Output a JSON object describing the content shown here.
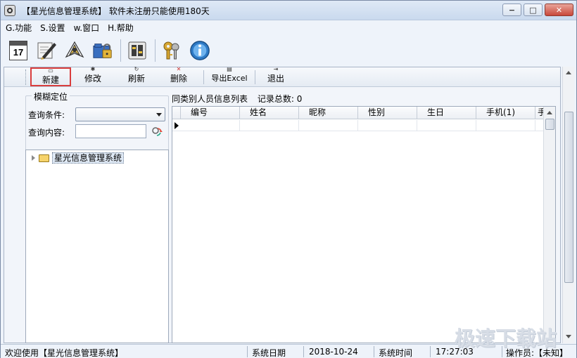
{
  "window": {
    "title": "【星光信息管理系统】 软件未注册只能使用180天",
    "minimize_glyph": "−",
    "maximize_glyph": "□",
    "close_glyph": "✕"
  },
  "menu": [
    {
      "label": "G.功能"
    },
    {
      "label": "S.设置"
    },
    {
      "label": "w.窗口"
    },
    {
      "label": "H.帮助"
    }
  ],
  "toolbar_icons": [
    "calendar-icon",
    "pen-icon",
    "compass-icon",
    "lock-folder-icon",
    "settings-icon",
    "keys-icon",
    "info-icon"
  ],
  "calendar_day": "17",
  "sub_toolbar": {
    "new": "新建",
    "edit": "修改",
    "refresh": "刷新",
    "delete": "删除",
    "export": "导出Excel",
    "exit": "退出"
  },
  "fuzzy": {
    "title": "模糊定位",
    "condition_label": "查询条件:",
    "condition_value": "",
    "content_label": "查询内容:",
    "content_value": ""
  },
  "tree": {
    "root": "星光信息管理系统"
  },
  "list": {
    "caption": "同类别人员信息列表",
    "count_label": "记录总数:",
    "count": "0",
    "columns": [
      "编号",
      "姓名",
      "昵称",
      "性别",
      "生日",
      "手机(1)",
      "手"
    ]
  },
  "status": {
    "welcome": "欢迎使用【星光信息管理系统】",
    "date_label": "系统日期",
    "date": "2018-10-24",
    "time_label": "系统时间",
    "time": "17:27:03",
    "operator": "操作员:【未知】"
  },
  "watermark": "极速下载站",
  "colors": {
    "highlight_border": "#d93d3d",
    "titlebar": "#c9d9ee",
    "close_button": "#c8473a"
  }
}
